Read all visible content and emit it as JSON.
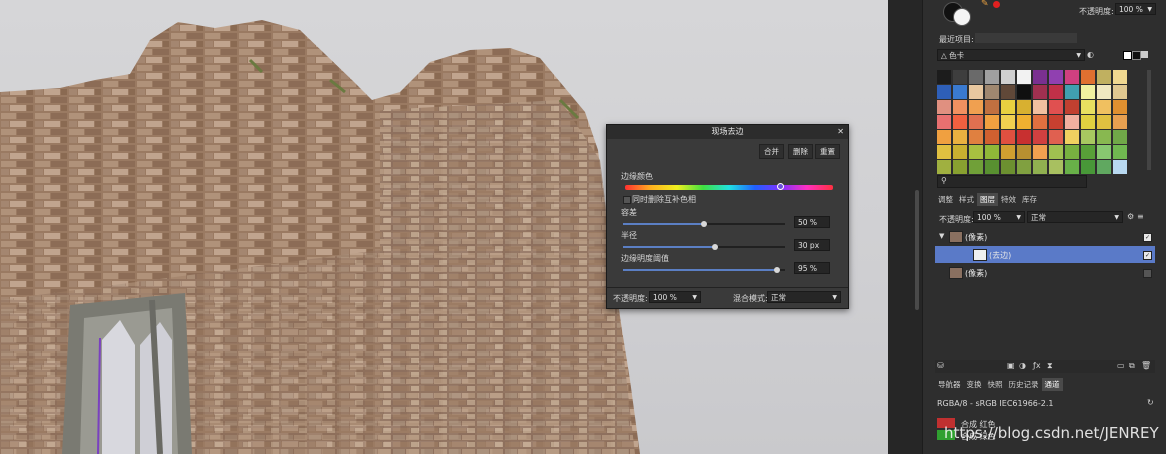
{
  "dialog": {
    "title": "现场去边",
    "close": "✕",
    "buttons": [
      "合并",
      "删除",
      "重置"
    ],
    "edge_color_label": "边缘颜色",
    "checkbox_label": "同时删除互补色相",
    "sliders": [
      {
        "label": "容差",
        "value": "50 %",
        "fraction": 0.5
      },
      {
        "label": "半径",
        "value": "30 px",
        "fraction": 0.57
      },
      {
        "label": "边缘明度阈值",
        "value": "95 %",
        "fraction": 0.95
      }
    ],
    "opacity_label": "不透明度:",
    "opacity_value": "100 %",
    "blend_label": "混合模式:",
    "blend_value": "正常"
  },
  "panel": {
    "opacity_label": "不透明度:",
    "opacity_value": "100 %",
    "recent_label": "最近项目:",
    "palette_name": "色卡",
    "swatches": [
      [
        "#1c1c1c",
        "#3e3e3e",
        "#6a6a6a",
        "#a0a0a0",
        "#d0d0d0",
        "#f2f2f2",
        "#7a3090",
        "#9040b0",
        "#d04080",
        "#e07030",
        "#c0b060",
        "#f0d890"
      ],
      [
        "#2e5fb8",
        "#3a7ad0",
        "#e8c8a0",
        "#a08870",
        "#604838",
        "#101010",
        "#a03050",
        "#c03048",
        "#40a0b0",
        "#f0f0a0",
        "#f0e8c0",
        "#e0c890"
      ],
      [
        "#e09080",
        "#f09060",
        "#f0a050",
        "#c07040",
        "#e8d040",
        "#d8b030",
        "#f0c0a0",
        "#e05050",
        "#c04030",
        "#e8e060",
        "#f0c060",
        "#e09030"
      ],
      [
        "#e87070",
        "#f06040",
        "#e07050",
        "#f0a040",
        "#f0d050",
        "#f0b030",
        "#e07040",
        "#c84030",
        "#f0b0a0",
        "#e0d040",
        "#e0c040",
        "#e8a050"
      ],
      [
        "#f0a040",
        "#e8b040",
        "#e08040",
        "#d06030",
        "#e05040",
        "#c83030",
        "#d04040",
        "#e06050",
        "#f0d060",
        "#a8c860",
        "#88b850",
        "#70a848"
      ],
      [
        "#e0c040",
        "#c8b030",
        "#a8c040",
        "#90b838",
        "#d0a030",
        "#b89030",
        "#f0a050",
        "#a0c050",
        "#78b040",
        "#58a038",
        "#88c870",
        "#70b850"
      ],
      [
        "#a0b040",
        "#88a030",
        "#70a038",
        "#589030",
        "#6c9030",
        "#80a040",
        "#90b050",
        "#a8c060",
        "#68b048",
        "#489838",
        "#60a860",
        "#b8d8f0"
      ]
    ],
    "layer_tabs": [
      "调整",
      "样式",
      "图层",
      "特效",
      "库存"
    ],
    "layer_tab_active": "图层",
    "layer_opacity_label": "不透明度:",
    "layer_opacity_value": "100 %",
    "layer_blend_value": "正常",
    "layers": [
      {
        "name": "(像素)",
        "indent": 0,
        "selected": false,
        "checked": true
      },
      {
        "name": "(去边)",
        "indent": 1,
        "selected": true,
        "checked": true
      },
      {
        "name": "(像素)",
        "indent": 0,
        "selected": false,
        "checked": false
      }
    ],
    "bottom_tabs": [
      "导航器",
      "变换",
      "快照",
      "历史记录",
      "通道"
    ],
    "bottom_tab_active": "通道",
    "color_profile": "RGBA/8 - sRGB IEC61966-2.1",
    "channels": [
      {
        "name": "合成 红色",
        "color": "#c03030"
      },
      {
        "name": "合成 绿色",
        "color": "#30a030"
      }
    ]
  },
  "watermark": "https://blog.csdn.net/JENREY"
}
